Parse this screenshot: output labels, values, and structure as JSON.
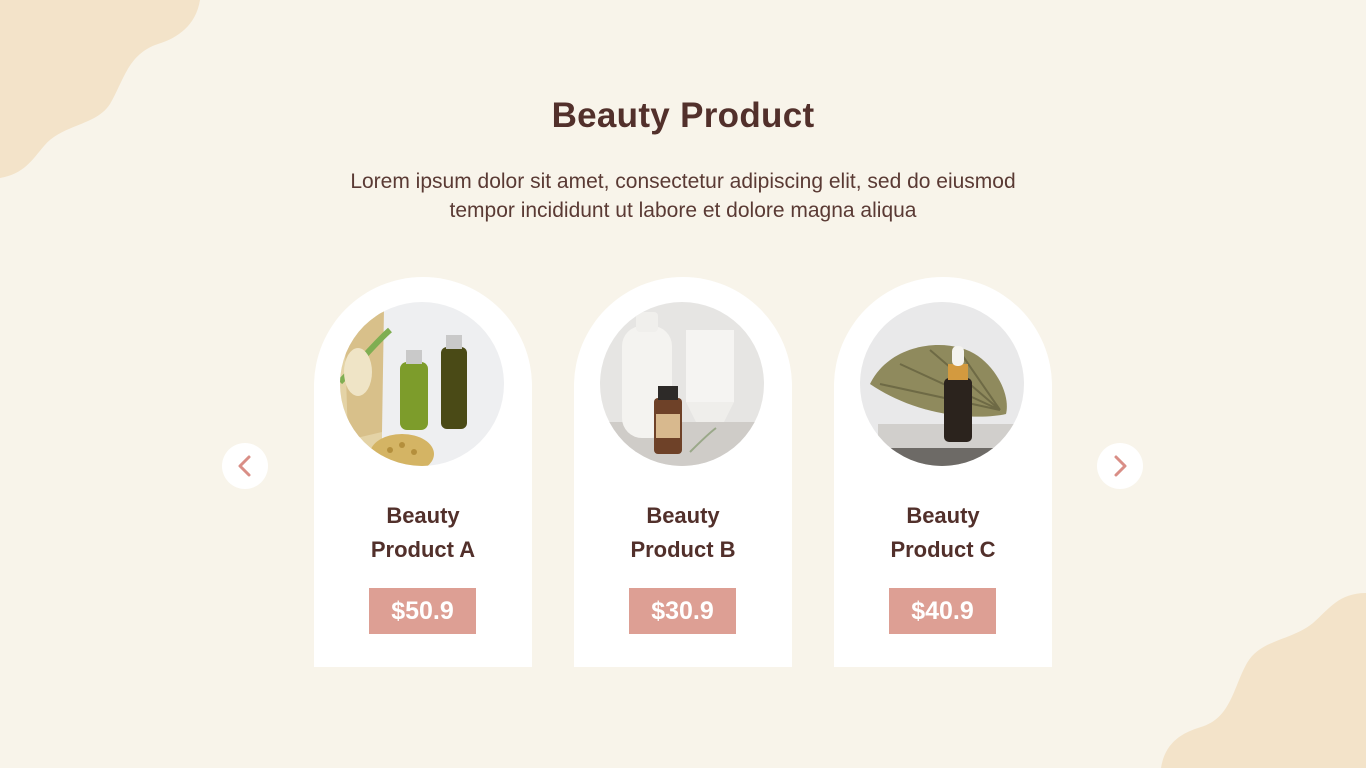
{
  "header": {
    "title": "Beauty Product",
    "description": "Lorem ipsum dolor sit amet, consectetur adipiscing elit, sed do eiusmod tempor incididunt ut labore et dolore magna aliqua"
  },
  "carousel": {
    "prev_icon": "chevron-left-icon",
    "next_icon": "chevron-right-icon",
    "products": [
      {
        "name_line1": "Beauty",
        "name_line2": "Product A",
        "price": "$50.9",
        "image": "green-bottles-photo"
      },
      {
        "name_line1": "Beauty",
        "name_line2": "Product B",
        "price": "$30.9",
        "image": "white-tubes-photo"
      },
      {
        "name_line1": "Beauty",
        "name_line2": "Product C",
        "price": "$40.9",
        "image": "dropper-leaf-photo"
      }
    ]
  },
  "colors": {
    "background": "#f8f4ea",
    "blob": "#f3e3c9",
    "card": "#ffffff",
    "price_badge": "#dd9f94",
    "text": "#52302b",
    "arrow": "#d98e86"
  }
}
